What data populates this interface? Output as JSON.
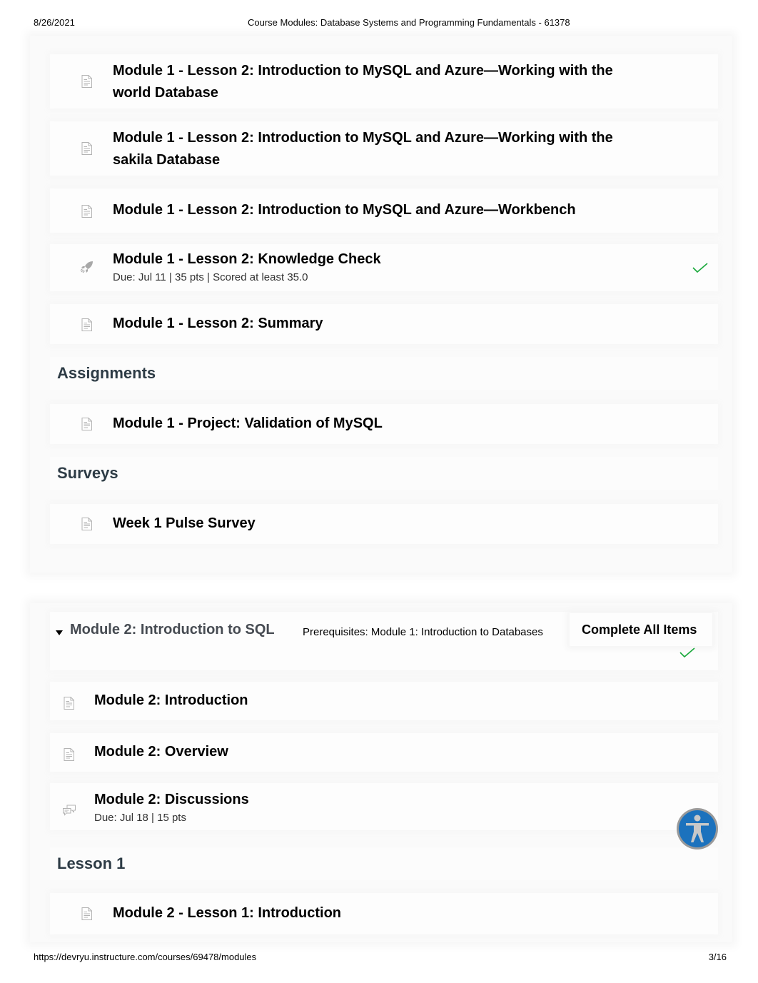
{
  "print_header": {
    "date": "8/26/2021",
    "title": "Course Modules: Database Systems and Programming Fundamentals - 61378"
  },
  "print_footer": {
    "url": "https://devryu.instructure.com/courses/69478/modules",
    "page": "3/16"
  },
  "module1": {
    "items": [
      {
        "icon": "page-icon",
        "title": "Module 1 - Lesson 2: Introduction to MySQL and Azure—Working with the world Database",
        "meta": "",
        "completed": false
      },
      {
        "icon": "page-icon",
        "title": "Module 1 - Lesson 2: Introduction to MySQL and Azure—Working with the sakila Database",
        "meta": "",
        "completed": false
      },
      {
        "icon": "page-icon",
        "title": "Module 1 - Lesson 2: Introduction to MySQL and Azure—Workbench",
        "meta": "",
        "completed": false
      },
      {
        "icon": "quiz-rocket-icon",
        "title": "Module 1 - Lesson 2: Knowledge Check",
        "meta": "Due: Jul 11 | 35 pts | Scored at least 35.0",
        "completed": true
      },
      {
        "icon": "page-icon",
        "title": "Module 1 - Lesson 2: Summary",
        "meta": "",
        "completed": false
      }
    ],
    "sections": [
      {
        "header": "Assignments",
        "items": [
          {
            "icon": "page-icon",
            "title": "Module 1 - Project: Validation of MySQL"
          }
        ]
      },
      {
        "header": "Surveys",
        "items": [
          {
            "icon": "page-icon",
            "title": "Week 1 Pulse Survey"
          }
        ]
      }
    ]
  },
  "module2": {
    "title": "Module 2: Introduction to SQL",
    "prerequisites": "Prerequisites: Module 1: Introduction to Databases",
    "requirement": "Complete All Items",
    "requirement_met": true,
    "items": [
      {
        "icon": "page-icon",
        "title": "Module 2: Introduction",
        "meta": ""
      },
      {
        "icon": "page-icon",
        "title": "Module 2: Overview",
        "meta": ""
      },
      {
        "icon": "discussion-icon",
        "title": "Module 2: Discussions",
        "meta": "Due: Jul 18 | 15 pts"
      }
    ],
    "sections": [
      {
        "header": "Lesson 1",
        "items": [
          {
            "icon": "page-icon",
            "title": "Module 2 - Lesson 1: Introduction"
          }
        ]
      }
    ]
  },
  "accessibility_button": {
    "icon": "accessibility-icon"
  },
  "colors": {
    "check_green": "#18a83a",
    "accessibility_blue": "#1c72bd",
    "header_text": "#2d3b45"
  }
}
